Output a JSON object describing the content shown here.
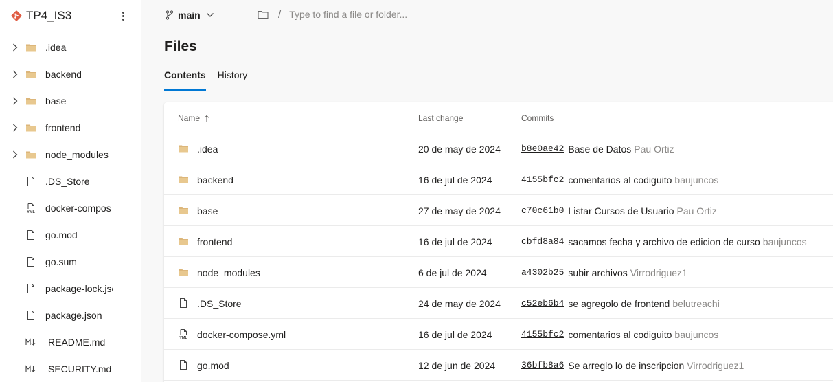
{
  "colors": {
    "accent": "#0078d4",
    "folder": "#dcb67a",
    "repo": "#e05d44"
  },
  "sidebar": {
    "repo_name": "TP4_IS3",
    "items": [
      {
        "label": ".idea",
        "type": "folder",
        "icon": "folder-icon"
      },
      {
        "label": "backend",
        "type": "folder",
        "icon": "folder-icon"
      },
      {
        "label": "base",
        "type": "folder",
        "icon": "folder-icon"
      },
      {
        "label": "frontend",
        "type": "folder",
        "icon": "folder-icon"
      },
      {
        "label": "node_modules",
        "type": "folder",
        "icon": "folder-icon"
      },
      {
        "label": ".DS_Store",
        "type": "file",
        "icon": "file-icon"
      },
      {
        "label": "docker-compos",
        "type": "yml",
        "icon": "yml-file-icon"
      },
      {
        "label": "go.mod",
        "type": "file",
        "icon": "file-icon"
      },
      {
        "label": "go.sum",
        "type": "file",
        "icon": "file-icon"
      },
      {
        "label": "package-lock.jso",
        "type": "file",
        "icon": "file-icon"
      },
      {
        "label": "package.json",
        "type": "file",
        "icon": "file-icon"
      },
      {
        "label": "README.md",
        "type": "md",
        "icon": "markdown-icon"
      },
      {
        "label": "SECURITY.md",
        "type": "md",
        "icon": "markdown-icon"
      }
    ]
  },
  "header": {
    "branch": "main",
    "path_separator": "/",
    "search_placeholder": "Type to find a file or folder..."
  },
  "main": {
    "title": "Files",
    "tabs": [
      {
        "label": "Contents",
        "active": true
      },
      {
        "label": "History",
        "active": false
      }
    ],
    "table": {
      "columns": {
        "name": "Name",
        "last_change": "Last change",
        "commits": "Commits"
      },
      "rows": [
        {
          "name": ".idea",
          "type": "folder",
          "date": "20 de may de 2024",
          "hash": "b8e0ae42",
          "message": "Base de Datos",
          "author": "Pau Ortiz"
        },
        {
          "name": "backend",
          "type": "folder",
          "date": "16 de jul de 2024",
          "hash": "4155bfc2",
          "message": "comentarios al codiguito",
          "author": "baujuncos"
        },
        {
          "name": "base",
          "type": "folder",
          "date": "27 de may de 2024",
          "hash": "c70c61b0",
          "message": "Listar Cursos de Usuario",
          "author": "Pau Ortiz"
        },
        {
          "name": "frontend",
          "type": "folder",
          "date": "16 de jul de 2024",
          "hash": "cbfd8a84",
          "message": "sacamos fecha y archivo de edicion de curso",
          "author": "baujuncos"
        },
        {
          "name": "node_modules",
          "type": "folder",
          "date": "6 de jul de 2024",
          "hash": "a4302b25",
          "message": "subir archivos",
          "author": "Virrodriguez1"
        },
        {
          "name": ".DS_Store",
          "type": "file",
          "date": "24 de may de 2024",
          "hash": "c52eb6b4",
          "message": "se agregolo de frontend",
          "author": "belutreachi"
        },
        {
          "name": "docker-compose.yml",
          "type": "yml",
          "date": "16 de jul de 2024",
          "hash": "4155bfc2",
          "message": "comentarios al codiguito",
          "author": "baujuncos"
        },
        {
          "name": "go.mod",
          "type": "file",
          "date": "12 de jun de 2024",
          "hash": "36bfb8a6",
          "message": "Se arreglo lo de inscripcion",
          "author": "Virrodriguez1"
        }
      ]
    }
  }
}
